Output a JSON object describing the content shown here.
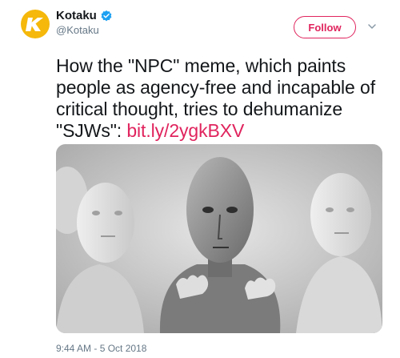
{
  "account": {
    "display_name": "Kotaku",
    "handle": "@Kotaku",
    "verified": true,
    "avatar_letter": "K",
    "avatar_color": "#f5b80b",
    "verified_color": "#1da1f2"
  },
  "actions": {
    "follow_label": "Follow",
    "menu_icon": "chevron-down-icon"
  },
  "tweet": {
    "text": "How the \"NPC\" meme, which paints people as agency-free and incapable of critical thought, tries to dehumanize \"SJWs\": ",
    "link_text": "bit.ly/2ygkBXV",
    "link_color": "#e0245e",
    "timestamp": "9:44 AM - 5 Oct 2018"
  },
  "media": {
    "kind": "grayscale illustration"
  }
}
